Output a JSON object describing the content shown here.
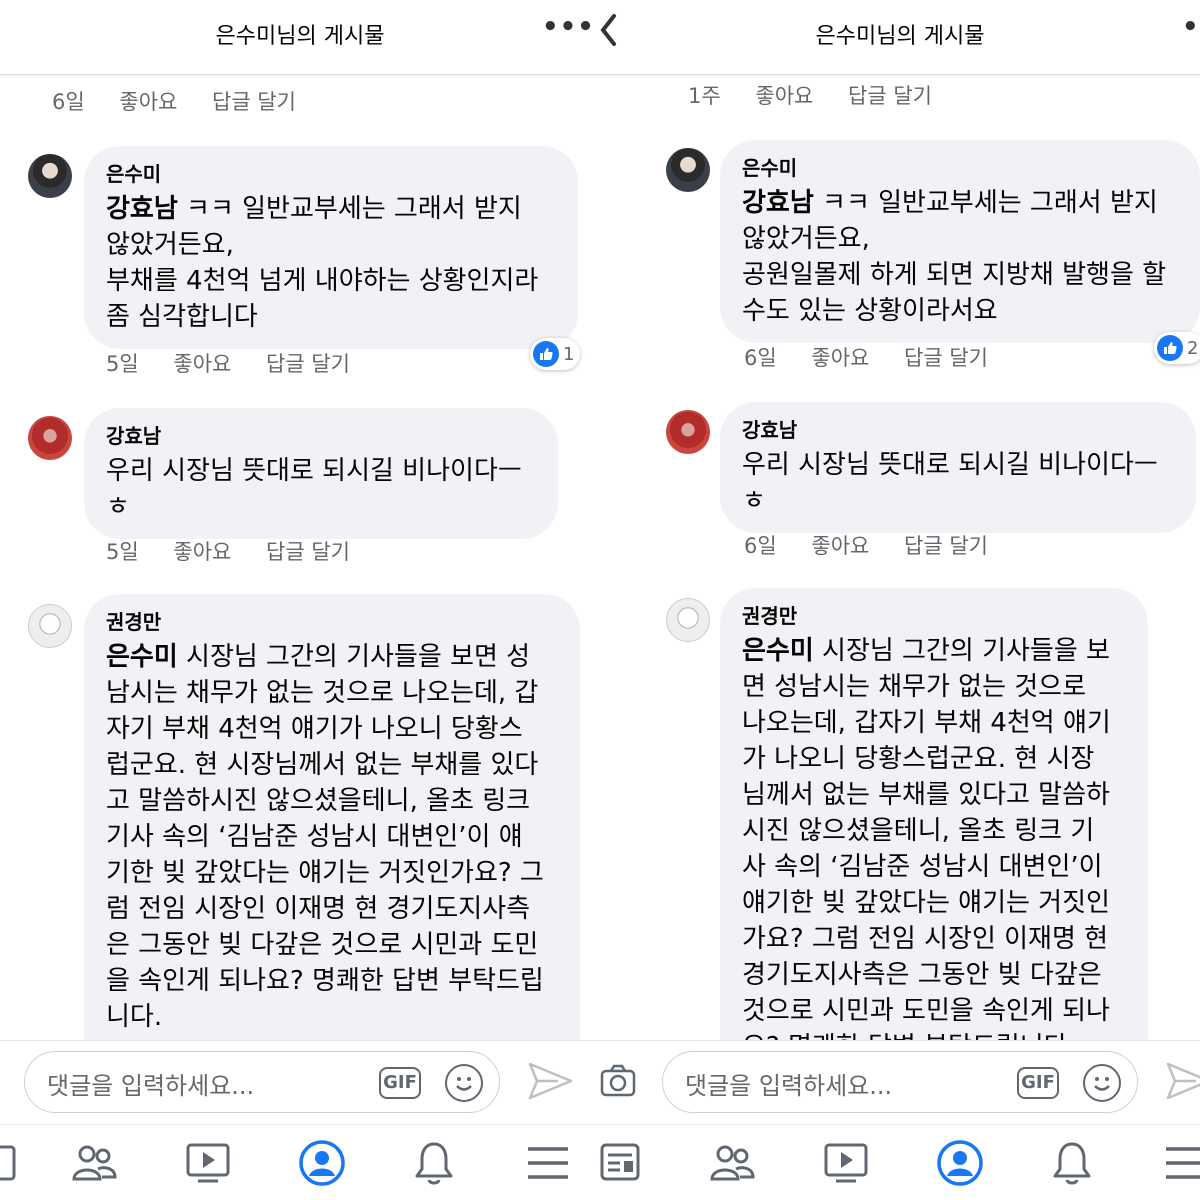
{
  "left": {
    "header": {
      "title": "은수미님의 게시물",
      "more": "•••"
    },
    "top_meta": {
      "time": "6일",
      "like": "좋아요",
      "reply": "답글 달기"
    },
    "comments": [
      {
        "author": "은수미",
        "mention": "강효남",
        "text": " ㅋㅋ 일반교부세는 그래서 받지\n않았거든요,\n부채를 4천억 넘게 내야하는 상황인지라\n좀 심각합니다",
        "time": "5일",
        "like": "좋아요",
        "reply": "답글 달기",
        "reactions": "1"
      },
      {
        "author": "강효남",
        "mention": "",
        "text": "우리 시장님 뜻대로 되시길 비나이다ㅡ\nㅎ",
        "time": "5일",
        "like": "좋아요",
        "reply": "답글 달기"
      },
      {
        "author": "권경만",
        "mention": "은수미",
        "text": " 시장님 그간의 기사들을 보면 성\n남시는 채무가 없는 것으로 나오는데, 갑\n자기 부채 4천억 얘기가 나오니 당황스\n럽군요. 현 시장님께서 없는 부채를 있다\n고 말씀하시진 않으셨을테니, 올초 링크\n기사 속의 ‘김남준 성남시 대변인’이 얘\n기한 빚 갚았다는 얘기는 거짓인가요? 그\n럼 전임 시장인 이재명 현 경기도지사측\n은 그동안 빚 다갚은 것으로 시민과 도민\n을 속인게 되나요? 명쾌한 답변 부탁드립\n니다."
      }
    ],
    "composer": {
      "placeholder": "댓글을 입력하세요...",
      "gif": "GIF"
    }
  },
  "right": {
    "header": {
      "title": "은수미님의 게시물",
      "more": "•••",
      "back": "‹"
    },
    "top_meta": {
      "time": "1주",
      "like": "좋아요",
      "reply": "답글 달기"
    },
    "comments": [
      {
        "author": "은수미",
        "mention": "강효남",
        "text": " ㅋㅋ 일반교부세는 그래서 받지\n않았거든요,\n공원일몰제 하게 되면 지방채 발행을 할\n수도 있는 상황이라서요",
        "time": "6일",
        "like": "좋아요",
        "reply": "답글 달기",
        "reactions": "2"
      },
      {
        "author": "강효남",
        "mention": "",
        "text": "우리 시장님 뜻대로 되시길 비나이다ㅡ\nㅎ",
        "time": "6일",
        "like": "좋아요",
        "reply": "답글 달기"
      },
      {
        "author": "권경만",
        "mention": "은수미",
        "text": " 시장님 그간의 기사들을 보\n면 성남시는 채무가 없는 것으로\n나오는데, 갑자기 부채 4천억 얘기\n가 나오니 당황스럽군요. 현 시장\n님께서 없는 부채를 있다고 말씀하\n시진 않으셨을테니, 올초 링크 기\n사 속의 ‘김남준 성남시 대변인’이\n얘기한 빚 갚았다는 얘기는 거짓인\n가요? 그럼 전임 시장인 이재명 현\n경기도지사측은 그동안 빚 다갚은\n것으로 시민과 도민을 속인게 되나\n요? 명쾌한 답변 부탁드립니다."
      }
    ],
    "composer": {
      "placeholder": "댓글을 입력하세요...",
      "gif": "GIF"
    }
  },
  "icons": [
    "more-icon",
    "back-icon",
    "like-icon",
    "gif-icon",
    "emoji-icon",
    "send-icon",
    "camera-icon",
    "friends-icon",
    "watch-icon",
    "profile-icon",
    "notifications-icon",
    "menu-icon",
    "news-feed-icon"
  ],
  "colors": {
    "like_blue": "#1877f2",
    "bubble_bg": "#f0f2f5",
    "meta_gray": "#65676b",
    "active_tab": "#1877f2"
  }
}
